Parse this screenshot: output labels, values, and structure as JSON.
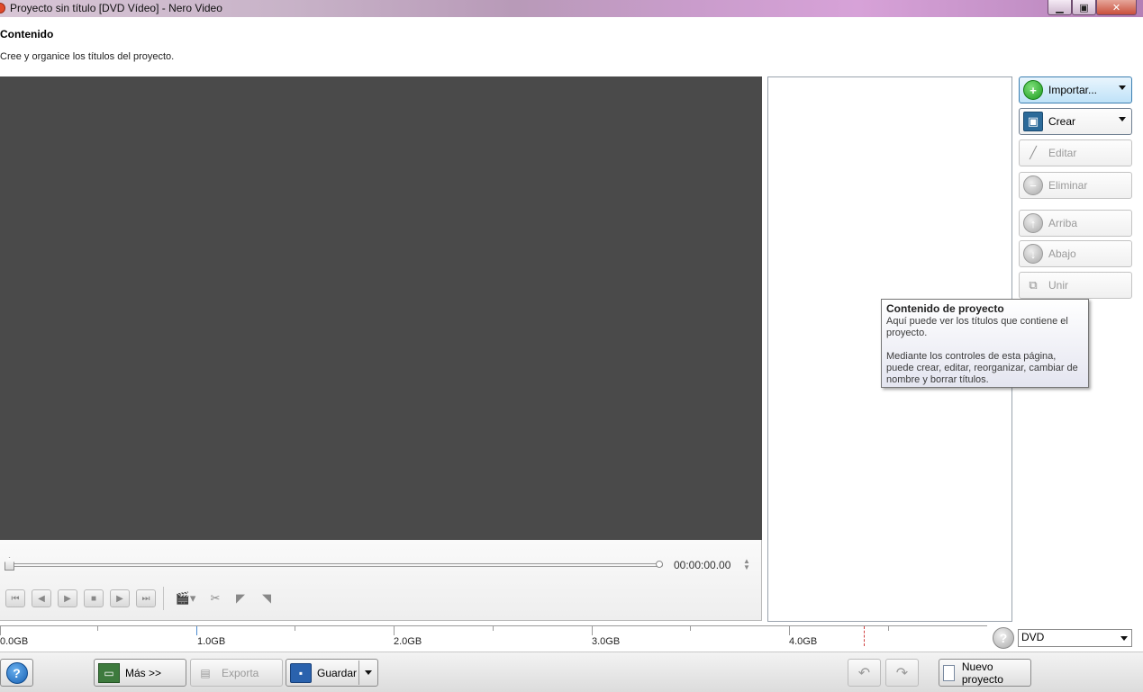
{
  "window": {
    "title": "Proyecto sin título [DVD Vídeo] - Nero Video",
    "minimize_glyph": "▁",
    "maximize_glyph": "▣",
    "close_glyph": "✕"
  },
  "header": {
    "title": "Contenido",
    "subtitle": "Cree y organice los títulos del proyecto."
  },
  "player": {
    "timecode": "00:00:00.00",
    "controls": [
      "go-to-start-icon",
      "previous-frame-icon",
      "play-icon",
      "stop-icon",
      "next-frame-icon",
      "go-to-end-icon",
      "chapter-menu-icon",
      "cut-icon",
      "mark-in-icon",
      "mark-out-icon"
    ]
  },
  "actions": {
    "importar": "Importar...",
    "crear": "Crear",
    "editar": "Editar",
    "eliminar": "Eliminar",
    "arriba": "Arriba",
    "abajo": "Abajo",
    "unir": "Unir"
  },
  "tooltip": {
    "title": "Contenido de proyecto",
    "line1": "Aquí puede ver los títulos que contiene el proyecto.",
    "line2": "Mediante los controles de esta página, puede crear, editar, reorganizar, cambiar de nombre y borrar títulos."
  },
  "capacity": {
    "labels": [
      "0.0GB",
      "1.0GB",
      "2.0GB",
      "3.0GB",
      "4.0GB"
    ],
    "used_gb": 0,
    "disc_capacity_gb": 4.7,
    "disc_type": "DVD"
  },
  "bottom": {
    "mas": "Más >>",
    "exporta": "Exporta",
    "guardar": "Guardar",
    "nuevo_proyecto": "Nuevo proyecto"
  },
  "colors": {
    "preview_bg": "#4a4a4a",
    "accent_blue": "#3c7fb1",
    "capacity_limit": "#d04040"
  }
}
